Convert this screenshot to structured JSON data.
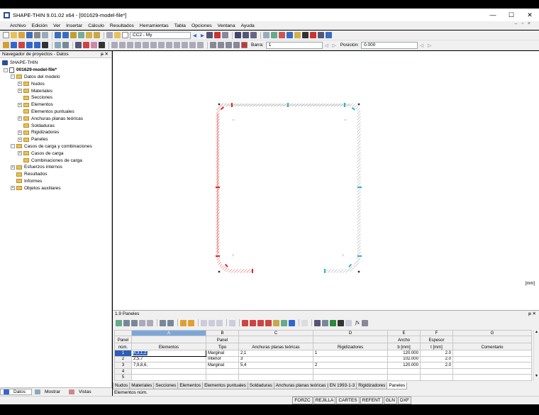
{
  "window": {
    "title": "SHAPE-THIN 9.01.02 x64 - [001629-model-file*]",
    "minimize": "—",
    "maximize": "☐",
    "close": "✕"
  },
  "menu": [
    "Archivo",
    "Edición",
    "Ver",
    "Insertar",
    "Cálculo",
    "Resultados",
    "Herramientas",
    "Tabla",
    "Opciones",
    "Ventana",
    "Ayuda"
  ],
  "toolbar1": {
    "loadcase": "CC2 - My"
  },
  "toolbar2": {
    "barra_label": "Barra:",
    "barra_value": "1",
    "posicion_label": "Posición:",
    "posicion_value": "0.000"
  },
  "navigator": {
    "title": "Navegador de proyectos - Datos",
    "root": "SHAPE-THIN",
    "file": "001629-model-file*",
    "items": [
      {
        "label": "Datos del modelo",
        "level": 2,
        "exp": "-"
      },
      {
        "label": "Nudos",
        "level": 3,
        "exp": "+"
      },
      {
        "label": "Materiales",
        "level": 3,
        "exp": "+"
      },
      {
        "label": "Secciones",
        "level": 3,
        "exp": ""
      },
      {
        "label": "Elementos",
        "level": 3,
        "exp": "+"
      },
      {
        "label": "Elementos puntuales",
        "level": 3,
        "exp": ""
      },
      {
        "label": "Anchuras planas teóricas",
        "level": 3,
        "exp": "+"
      },
      {
        "label": "Soldaduras",
        "level": 3,
        "exp": ""
      },
      {
        "label": "Rigidizadores",
        "level": 3,
        "exp": "+"
      },
      {
        "label": "Paneles",
        "level": 3,
        "exp": "+"
      },
      {
        "label": "Casos de carga y combinaciones",
        "level": 2,
        "exp": "-"
      },
      {
        "label": "Casos de carga",
        "level": 3,
        "exp": "+"
      },
      {
        "label": "Combinaciones de carga",
        "level": 3,
        "exp": ""
      },
      {
        "label": "Esfuerzos internos",
        "level": 2,
        "exp": "+"
      },
      {
        "label": "Resultados",
        "level": 2,
        "exp": ""
      },
      {
        "label": "Informes",
        "level": 2,
        "exp": ""
      },
      {
        "label": "Objetos auxiliares",
        "level": 2,
        "exp": "+"
      }
    ],
    "tabs": [
      "Datos",
      "Mostrar",
      "Vistas"
    ]
  },
  "canvas": {
    "unit": "[mm]"
  },
  "panel": {
    "title": "1.9 Paneles",
    "columns": [
      "A",
      "B",
      "C",
      "D",
      "E",
      "F",
      "G"
    ],
    "headers": {
      "panel_top": "Panel",
      "panel_bot": "núm.",
      "a_bot": "Elementos",
      "b_top": "Panel",
      "b_bot": "Tipo",
      "c_bot": "Anchuras planas teóricas",
      "d_bot": "Rigidizadores",
      "e_top": "Ancho",
      "e_bot": "b [mm]",
      "f_top": "Espesor",
      "f_bot": "t [mm]",
      "g_bot": "Comentario"
    },
    "rows": [
      {
        "n": "1",
        "a": "4,3,1,2,",
        "b": "Marginal",
        "c": "2,1",
        "d": "1",
        "e": "120.000",
        "f": "2.0",
        "g": ""
      },
      {
        "n": "2",
        "a": "2,5,7",
        "b": "Interior",
        "c": "3",
        "d": "",
        "e": "102.000",
        "f": "2.0",
        "g": ""
      },
      {
        "n": "3",
        "a": "7,9,8,6,",
        "b": "Marginal",
        "c": "5,4",
        "d": "2",
        "e": "120.000",
        "f": "2.0",
        "g": ""
      },
      {
        "n": "4",
        "a": "",
        "b": "",
        "c": "",
        "d": "",
        "e": "",
        "f": "",
        "g": ""
      },
      {
        "n": "5",
        "a": "",
        "b": "",
        "c": "",
        "d": "",
        "e": "",
        "f": "",
        "g": ""
      }
    ],
    "tabs": [
      "Nudos",
      "Materiales",
      "Secciones",
      "Elementos",
      "Elementos puntuales",
      "Soldaduras",
      "Anchuras planas teóricas | EN 1993-1-3",
      "Rigidizadores",
      "Paneles"
    ],
    "status": "Elementos núm."
  },
  "statusbar": [
    "FORZC",
    "REJILLA",
    "CARTES",
    "REFENT",
    "GLN",
    "DXF"
  ],
  "colors": {
    "accent": "#2b5fb8",
    "section_red": "#d42a2a",
    "node_cyan": "#2ab3c8",
    "folder": "#e8c15a"
  }
}
